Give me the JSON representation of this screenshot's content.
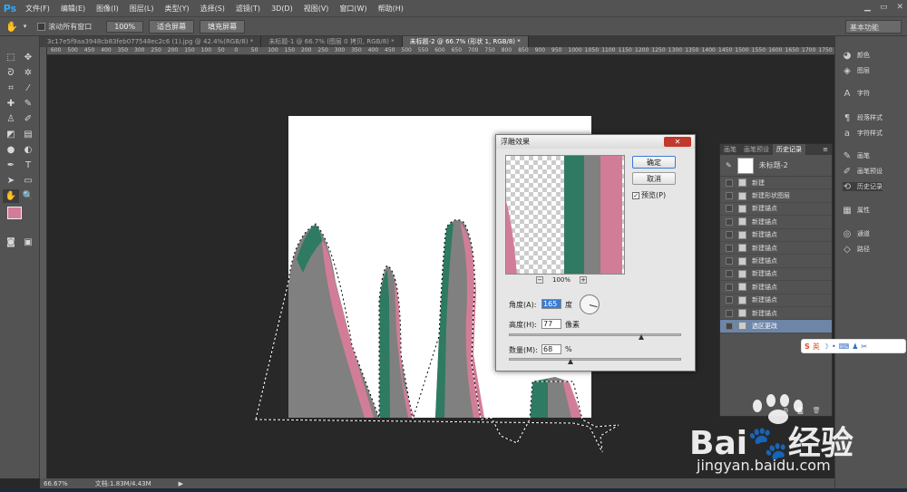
{
  "app": {
    "logo": "Ps"
  },
  "menu": [
    "文件(F)",
    "编辑(E)",
    "图像(I)",
    "图层(L)",
    "类型(Y)",
    "选择(S)",
    "滤镜(T)",
    "3D(D)",
    "视图(V)",
    "窗口(W)",
    "帮助(H)"
  ],
  "options": {
    "scroll_all_label": "滚动所有窗口",
    "zoom_100": "100%",
    "fit_screen": "适合屏幕",
    "fill_screen": "填充屏幕",
    "workspace": "基本功能"
  },
  "tabs": [
    {
      "label": "3c17e5f9aa3948cb83feb077548ec2c6 (1).jpg @ 42.4%(RGB/8) *"
    },
    {
      "label": "未标题-1 @ 66.7% (图层 0 拷贝, RGB/8) *"
    },
    {
      "label": "未标题-2 @ 66.7% (形状 1, RGB/8) *"
    }
  ],
  "ruler_ticks": [
    "600",
    "500",
    "450",
    "400",
    "350",
    "300",
    "250",
    "200",
    "150",
    "100",
    "50",
    "0",
    "50",
    "100",
    "150",
    "200",
    "250",
    "300",
    "350",
    "400",
    "450",
    "500",
    "550",
    "600",
    "650",
    "700",
    "750",
    "800",
    "850",
    "900",
    "950",
    "1000",
    "1050",
    "1100",
    "1150",
    "1200",
    "1250",
    "1300",
    "1350",
    "1400",
    "1450",
    "1500",
    "1550",
    "1600",
    "1650",
    "1700",
    "1750"
  ],
  "status": {
    "zoom": "66.67%",
    "doc": "文档:1.83M/4.43M"
  },
  "dialog": {
    "title": "浮雕效果",
    "ok": "确定",
    "cancel": "取消",
    "preview_label": "预览(P)",
    "preview_zoom": "100%",
    "angle_label": "角度(A):",
    "angle_value": "165",
    "angle_unit": "度",
    "height_label": "高度(H):",
    "height_value": "77",
    "height_unit": "像素",
    "amount_label": "数量(M):",
    "amount_value": "68",
    "amount_unit": "%",
    "height_slider": 0.77,
    "amount_slider": 0.36
  },
  "history": {
    "tabs": [
      "画笔",
      "画笔预设",
      "历史记录"
    ],
    "snapshot": "未标题-2",
    "items": [
      "新建",
      "新建形状图层",
      "新建锚点",
      "新建锚点",
      "新建锚点",
      "新建锚点",
      "新建锚点",
      "新建锚点",
      "新建锚点",
      "新建锚点",
      "新建锚点",
      "选区更改"
    ]
  },
  "dock": [
    {
      "icon": "palette-icon",
      "label": "颜色"
    },
    {
      "icon": "layers-icon",
      "label": "图层"
    },
    {
      "icon": "text-icon",
      "label": "字符"
    },
    {
      "icon": "paragraph-style-icon",
      "label": "段落样式"
    },
    {
      "icon": "char-style-icon",
      "label": "字符样式"
    },
    {
      "icon": "brush-icon",
      "label": "画笔"
    },
    {
      "icon": "brush-preset-icon",
      "label": "画笔预设"
    },
    {
      "icon": "history-icon",
      "label": "历史记录"
    },
    {
      "icon": "properties-icon",
      "label": "属性"
    },
    {
      "icon": "channels-icon",
      "label": "通道"
    },
    {
      "icon": "paths-icon",
      "label": "路径"
    }
  ],
  "ime": {
    "label": "英"
  },
  "watermark": {
    "brand_a": "Bai",
    "brand_b": "经验",
    "url": "jingyan.baidu.com"
  },
  "colors": {
    "green": "#2e7a62",
    "pink": "#d27d97",
    "gray": "#808080",
    "selection": "#6d86a8"
  }
}
